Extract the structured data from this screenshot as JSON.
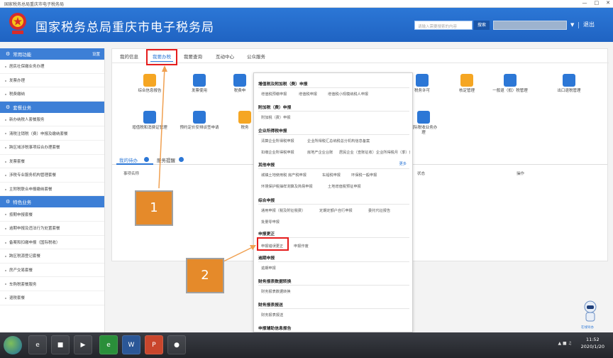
{
  "titlebar": {
    "title": "国家税务总局重庆市电子税务局"
  },
  "header": {
    "site_title": "国家税务总局重庆市电子税务局",
    "search_placeholder": "请输入需要搜索的内容",
    "search_button": "搜索",
    "logout": "退出"
  },
  "sidebar": {
    "sections": [
      {
        "title": "常用功能",
        "action": "设置",
        "items": [
          "居民社保缴业务办理",
          "发票办理",
          "税费缴纳"
        ]
      },
      {
        "title": "套餐业务",
        "action": "",
        "items": [
          "新办纳税人套餐服务",
          "清税注销税（费）申报及缴纳套餐",
          "跨区域涉税事项综合办理套餐",
          "发票套餐",
          "涉税专业服务机构管理套餐",
          "主附税联合申报缴纳套餐"
        ]
      },
      {
        "title": "特色业务",
        "action": "",
        "items": [
          "按期申报套餐",
          "逾期申报及违法行为处置套餐",
          "备案和扣缴申报（国际税收）",
          "跨区税源登记套餐",
          "房产交易套餐",
          "车购税套餐服务",
          "退税套餐"
        ]
      }
    ]
  },
  "main": {
    "tabs": [
      "我的信息",
      "我要办税",
      "我要查询",
      "互动中心",
      "公众服务"
    ],
    "active_tab": "我要办税",
    "tiles": [
      {
        "label": "综合信息报告",
        "color": "#f5a623"
      },
      {
        "label": "发票使用",
        "color": "#2c77d6"
      },
      {
        "label": "税费申",
        "color": "#2c77d6"
      },
      {
        "label": "税务许可",
        "color": "#2c77d6"
      },
      {
        "label": "核定管理",
        "color": "#f5a623"
      },
      {
        "label": "一般退（抵）税管理",
        "color": "#2c77d6"
      },
      {
        "label": "出口退税管理",
        "color": "#2c77d6"
      },
      {
        "label": "增值税和消费证管理",
        "color": "#2c77d6"
      },
      {
        "label": "预约定价安排谈签申请",
        "color": "#2c77d6"
      },
      {
        "label": "税务",
        "color": "#f5a623"
      },
      {
        "label": "国际税收业务办理",
        "color": "#2c77d6"
      }
    ],
    "lower_tabs": [
      "我的待办",
      "服务提醒"
    ],
    "table_headers": [
      "事项名称",
      "状态",
      "操作"
    ]
  },
  "dropdown": {
    "sections": [
      {
        "title": "增值税及附加税（费）申报",
        "links": [
          "增值税预缴申报",
          "增值税申报",
          "增值税小规模纳税人申报"
        ]
      },
      {
        "title": "附加税（费）申报",
        "links": [
          "附加税（费）申报"
        ]
      },
      {
        "title": "企业所得税申报",
        "links": [
          "清算企业所得税申报",
          "企业所得税汇总纳税总分机构信息备案",
          "扣缴企业所得税申报",
          "房地产企业台账",
          "居民企业（查账征收）企业所得税月（季）度申报"
        ]
      },
      {
        "title": "其他申报",
        "more": "更多",
        "links": [
          "城镇土地使用税 房产税申报",
          "车船税申报",
          "环保税一般申报",
          "环境保护税抽样测算及简易申报",
          "土地增值税预征申报"
        ]
      },
      {
        "title": "综合申报",
        "links": [
          "通用申报（税及附征税费）",
          "定期定额户自行申报",
          "委托代征报告",
          "批量零申报"
        ]
      },
      {
        "title": "申报更正",
        "links": [
          "申报错误更正",
          "申报作废"
        ]
      },
      {
        "title": "逾期申报",
        "links": [
          "逾期申报"
        ]
      },
      {
        "title": "财务报表数据转换",
        "links": [
          "财务报表数据转换"
        ]
      },
      {
        "title": "财务报表报送",
        "links": [
          "财务报表报送"
        ]
      },
      {
        "title": "申报辅助信息报告",
        "links": []
      }
    ]
  },
  "annotations": {
    "step1": "1",
    "step2": "2"
  },
  "chatbot": {
    "label": "在线导办"
  },
  "taskbar": {
    "time": "11:52",
    "date": "2020/1/20"
  },
  "colors": {
    "primary": "#2c77d6",
    "annotation_red": "#e51c1c",
    "annotation_orange": "#e58a2a"
  }
}
